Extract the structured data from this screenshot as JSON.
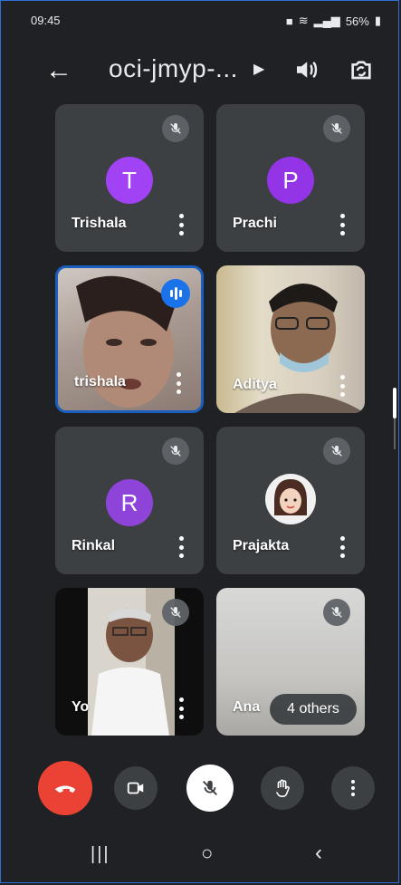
{
  "status_bar": {
    "time": "09:45",
    "battery": "56%"
  },
  "header": {
    "meeting_code": "oci-jmyp-..."
  },
  "participants": [
    {
      "name": "Trishala",
      "initial": "T",
      "avatar_color": "#a142f4",
      "muted": true
    },
    {
      "name": "Prachi",
      "initial": "P",
      "avatar_color": "#9334e6",
      "muted": true
    },
    {
      "name": "trishala",
      "speaking": true
    },
    {
      "name": "Aditya"
    },
    {
      "name": "Rinkal",
      "initial": "R",
      "avatar_color": "#8e44d9",
      "muted": true
    },
    {
      "name": "Prajakta",
      "muted": true
    },
    {
      "name": "Yo",
      "muted": true
    },
    {
      "name": "Ana",
      "muted": true
    }
  ],
  "others_badge": "4 others",
  "colors": {
    "background": "#202124",
    "tile": "#3c4043",
    "end_call": "#ea4335",
    "speaking": "#1a73e8"
  },
  "controls": {
    "end_call": "end-call-icon",
    "camera": "video-camera-icon",
    "microphone": "mic-off-icon",
    "raise_hand": "raise-hand-icon",
    "more": "more-vert-icon"
  }
}
